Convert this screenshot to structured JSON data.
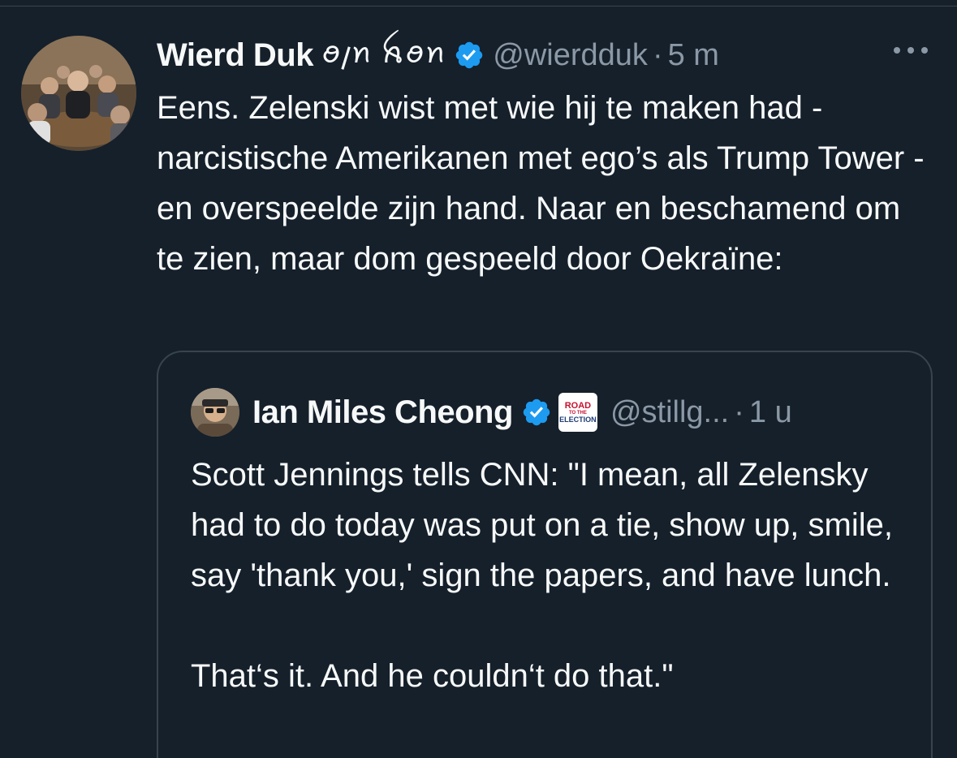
{
  "tweet": {
    "author_name": "Wierd Duk",
    "author_name_glyphs": "ꪮ𐑢ꪀ ꫝꪮꪀ",
    "handle": "@wierdduk",
    "separator": "·",
    "time": "5 m",
    "text": "Eens. Zelenski wist met wie hij te maken had - narcistische Amerikanen met ego’s als Trump Tower - en overspeelde zijn hand. Naar en beschamend om te zien, maar dom gespeeld door Oekraïne:"
  },
  "quote": {
    "author_name": "Ian Miles Cheong",
    "badge_line1": "ROAD",
    "badge_line2": "TO THE",
    "badge_line3": "ELECTION",
    "handle": "@stillg...",
    "separator": "·",
    "time": "1 u",
    "text": "Scott Jennings tells CNN: \"I mean, all Zelensky had to do today was put on a tie, show up, smile, say 'thank you,' sign the papers, and have lunch.\n\nThat‘s it. And he couldn‘t do that.\""
  },
  "colors": {
    "background": "#15202b",
    "text_primary": "#f7f9f9",
    "text_secondary": "#8b98a5",
    "border": "#38444d",
    "verified_blue": "#1d9bf0"
  },
  "icons": {
    "verified": "verified-badge-icon",
    "more": "more-dots-icon"
  }
}
